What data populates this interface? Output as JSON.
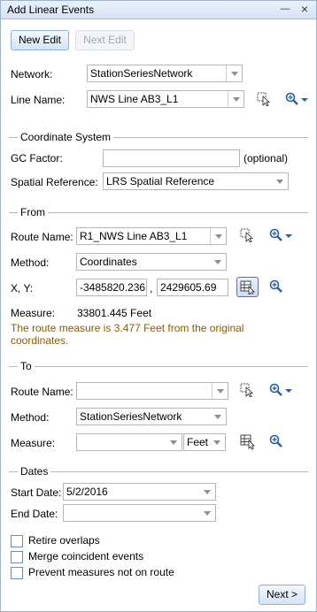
{
  "window": {
    "title": "Add Linear Events",
    "close_glyph": "×",
    "collapse_glyph": "—"
  },
  "toolbar": {
    "new_edit": "New Edit",
    "next_edit": "Next Edit"
  },
  "network": {
    "label": "Network:",
    "value": "StationSeriesNetwork"
  },
  "line_name": {
    "label": "Line Name:",
    "value": "NWS Line AB3_L1"
  },
  "coordinate_system": {
    "section": "Coordinate System",
    "gc_factor_label": "GC Factor:",
    "gc_factor_value": "",
    "gc_factor_hint": "(optional)",
    "spatial_ref_label": "Spatial Reference:",
    "spatial_ref_value": "LRS Spatial Reference"
  },
  "from": {
    "section": "From",
    "route_label": "Route Name:",
    "route_value": "R1_NWS Line AB3_L1",
    "method_label": "Method:",
    "method_value": "Coordinates",
    "xy_label": "X, Y:",
    "x_value": "-3485820.236",
    "y_value": "2429605.69",
    "comma": ",",
    "measure_label": "Measure:",
    "measure_value": "33801.445 Feet",
    "message_line1": "The route measure is 3.477 Feet from the original",
    "message_line2": "coordinates."
  },
  "to": {
    "section": "To",
    "route_label": "Route Name:",
    "route_value": "",
    "method_label": "Method:",
    "method_value": "StationSeriesNetwork",
    "measure_label": "Measure:",
    "measure_value": "",
    "unit_value": "Feet"
  },
  "dates": {
    "section": "Dates",
    "start_label": "Start Date:",
    "start_value": "5/2/2016",
    "end_label": "End Date:",
    "end_value": ""
  },
  "options": {
    "retire_overlaps": "Retire overlaps",
    "merge_coincident": "Merge coincident events",
    "prevent_measures": "Prevent measures not on route"
  },
  "footer": {
    "next": "Next >"
  },
  "colors": {
    "accent": "#3b78c2",
    "message": "#8b5a00",
    "title_bg": "#d5e3f3"
  }
}
